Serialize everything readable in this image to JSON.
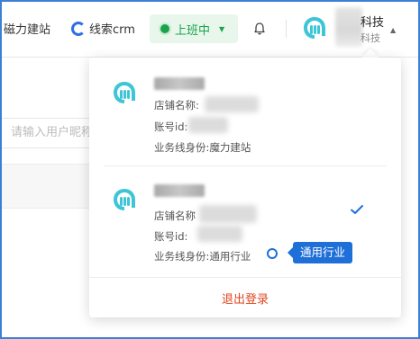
{
  "header": {
    "nav_item_1": "磁力建站",
    "nav_item_2": "线索crm",
    "status_label": "上班中",
    "company_name": "科技",
    "company_sub": "科技"
  },
  "background": {
    "search_placeholder": "请输入用户昵称"
  },
  "dropdown": {
    "accounts": [
      {
        "shop_label": "店铺名称:",
        "id_label": "账号id:",
        "role_label": "业务线身份:",
        "role_value": "魔力建站",
        "selected": false
      },
      {
        "shop_label": "店铺名称",
        "id_label": "账号id:",
        "role_label": "业务线身份:",
        "role_value": "通用行业",
        "selected": true,
        "tooltip": "通用行业"
      }
    ],
    "logout_label": "退出登录"
  },
  "colors": {
    "accent": "#1f6fd8",
    "status_green": "#1aa34a",
    "logout_red": "#e0461e",
    "logo_teal": "#3ec6d6"
  },
  "icons": {
    "crm": "crm-logo-icon",
    "status": "status-dot-icon",
    "bell": "bell-icon",
    "brand": "brand-logo-icon",
    "check": "checkmark-icon"
  }
}
